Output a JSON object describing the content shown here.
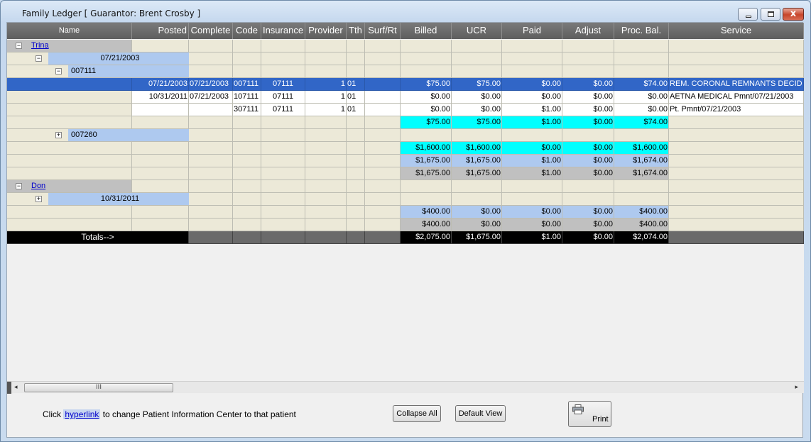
{
  "window": {
    "title": "Family Ledger [ Guarantor: Brent Crosby ]",
    "close_glyph": "x"
  },
  "columns": {
    "name": "Name",
    "posted": "Posted",
    "complete": "Complete",
    "code": "Code",
    "insurance": "Insurance",
    "provider": "Provider",
    "tth": "Tth",
    "surf": "Surf/Rt",
    "billed": "Billed",
    "ucr": "UCR",
    "paid": "Paid",
    "adjust": "Adjust",
    "proc_bal": "Proc. Bal.",
    "service": "Service"
  },
  "tree": {
    "patient1": "Trina",
    "date1": "07/21/2003",
    "code1": "007111",
    "code2": "007260",
    "patient2": "Don",
    "date2": "10/31/2011",
    "expand_minus": "−",
    "expand_plus": "+"
  },
  "rows": [
    {
      "posted": "07/21/2003",
      "complete": "07/21/2003",
      "code": "007111",
      "insurance": "07111",
      "provider": "1",
      "tth": "01",
      "surf": "",
      "billed": "$75.00",
      "ucr": "$75.00",
      "paid": "$0.00",
      "adjust": "$0.00",
      "bal": "$74.00",
      "service": "REM. CORONAL REMNANTS DECID"
    },
    {
      "posted": "10/31/2011",
      "complete": "07/21/2003",
      "code": "107111",
      "insurance": "07111",
      "provider": "1",
      "tth": "01",
      "surf": "",
      "billed": "$0.00",
      "ucr": "$0.00",
      "paid": "$0.00",
      "adjust": "$0.00",
      "bal": "$0.00",
      "service": "AETNA MEDICAL Pmnt/07/21/2003"
    },
    {
      "posted": "",
      "complete": "",
      "code": "307111",
      "insurance": "07111",
      "provider": "1",
      "tth": "01",
      "surf": "",
      "billed": "$0.00",
      "ucr": "$0.00",
      "paid": "$1.00",
      "adjust": "$0.00",
      "bal": "$0.00",
      "service": "Pt. Pmnt/07/21/2003"
    }
  ],
  "subtotals": [
    {
      "billed": "$75.00",
      "ucr": "$75.00",
      "paid": "$1.00",
      "adjust": "$0.00",
      "bal": "$74.00"
    },
    {
      "billed": "$1,600.00",
      "ucr": "$1,600.00",
      "paid": "$0.00",
      "adjust": "$0.00",
      "bal": "$1,600.00"
    },
    {
      "billed": "$1,675.00",
      "ucr": "$1,675.00",
      "paid": "$1.00",
      "adjust": "$0.00",
      "bal": "$1,674.00"
    },
    {
      "billed": "$1,675.00",
      "ucr": "$1,675.00",
      "paid": "$1.00",
      "adjust": "$0.00",
      "bal": "$1,674.00"
    },
    {
      "billed": "$400.00",
      "ucr": "$0.00",
      "paid": "$0.00",
      "adjust": "$0.00",
      "bal": "$400.00"
    },
    {
      "billed": "$400.00",
      "ucr": "$0.00",
      "paid": "$0.00",
      "adjust": "$0.00",
      "bal": "$400.00"
    }
  ],
  "totals": {
    "label": "Totals-->",
    "billed": "$2,075.00",
    "ucr": "$1,675.00",
    "paid": "$1.00",
    "adjust": "$0.00",
    "bal": "$2,074.00"
  },
  "scroll": {
    "thumb_grip": "III",
    "left": "◂",
    "right": "▸"
  },
  "footer": {
    "prefix": "Click ",
    "link": "hyperlink",
    "suffix": " to change Patient Information Center to that  patient"
  },
  "buttons": {
    "collapse": "Collapse All",
    "default": "Default View",
    "print": "Print"
  },
  "colors": {
    "selected": "#3166c7",
    "cyan": "#00ffff",
    "lightblue": "#aec9ef",
    "gray": "#c0c0c0",
    "beige": "#ece9d8"
  }
}
